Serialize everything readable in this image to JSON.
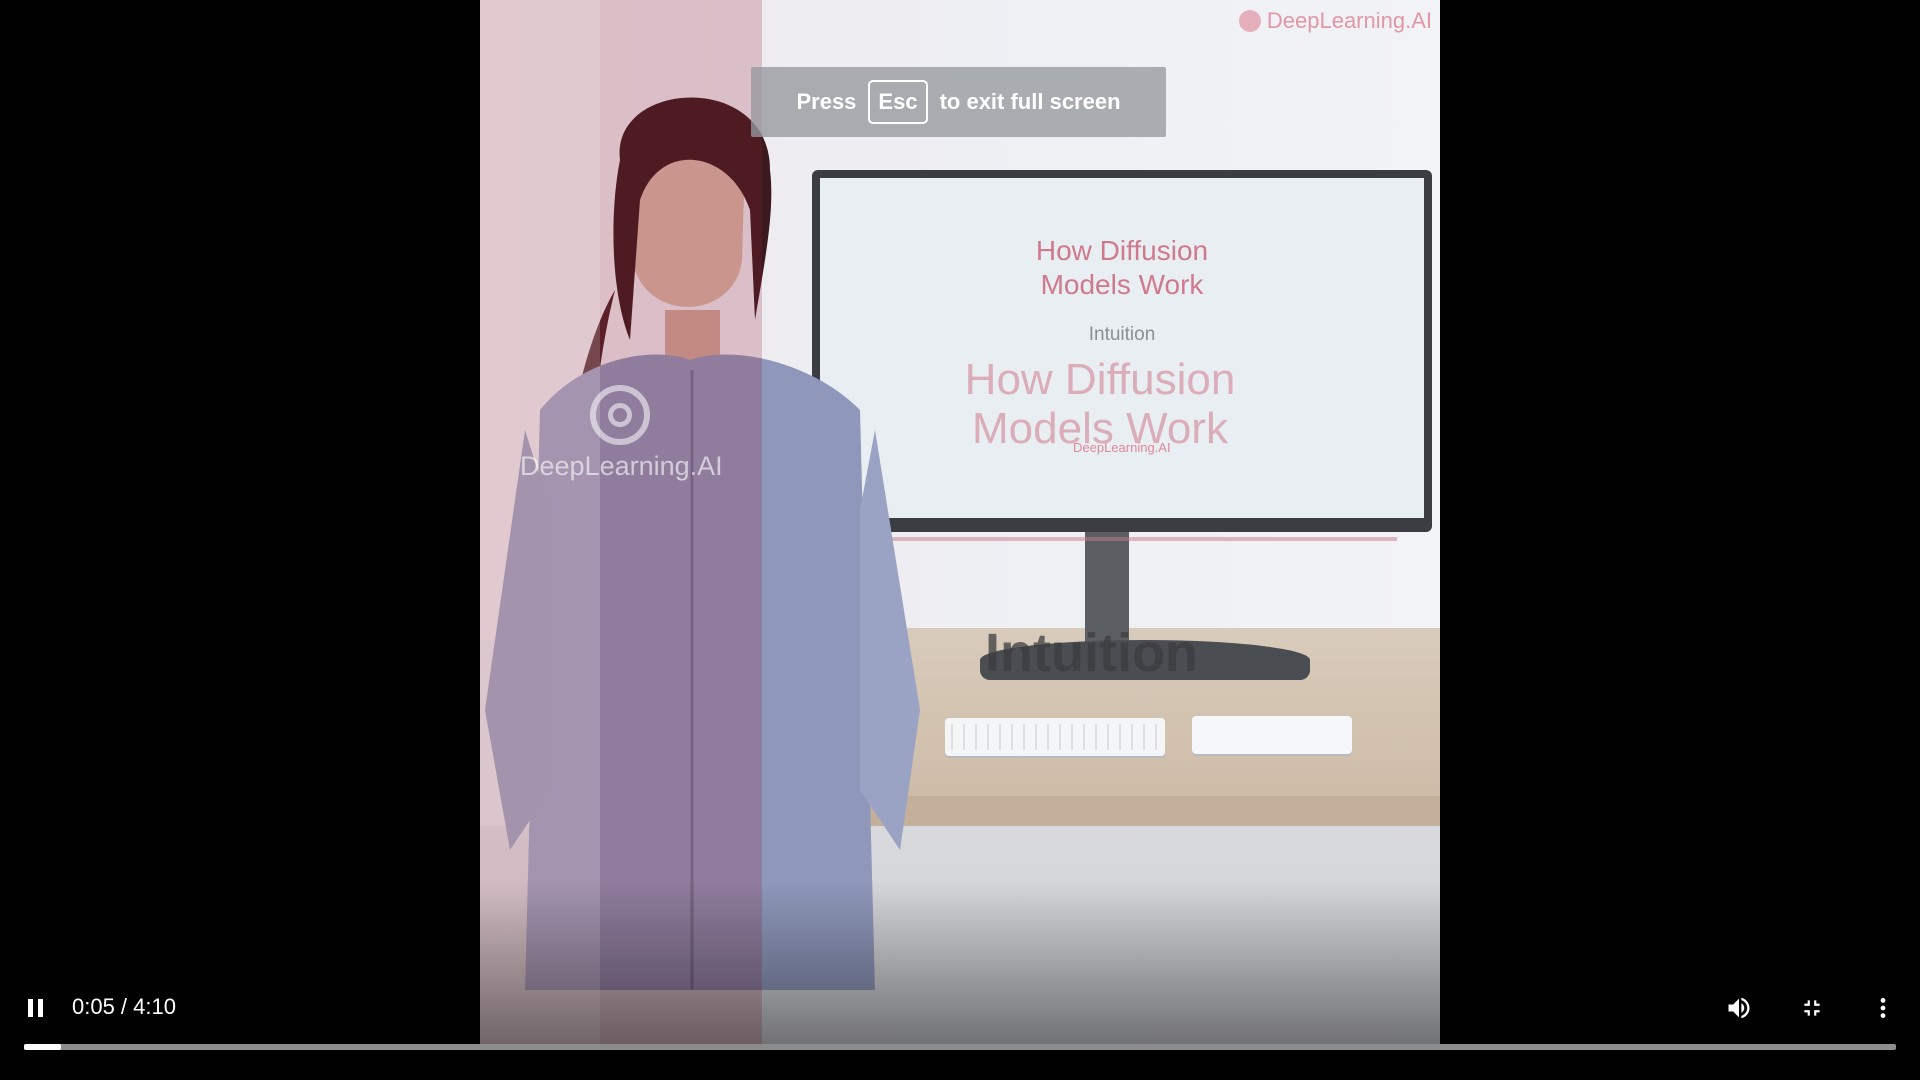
{
  "toast": {
    "press": "Press",
    "key": "Esc",
    "suffix": "to exit full screen"
  },
  "video": {
    "corner_logo": "DeepLearning.AI",
    "side_logo": "DeepLearning.AI",
    "screen_title_line1": "How Diffusion",
    "screen_title_line2": "Models Work",
    "screen_subtitle": "Intuition",
    "ghost_title_line1": "How Diffusion",
    "ghost_title_line2": "Models Work",
    "ghost_logo_text": "DeepLearning.AI",
    "ghost_subtitle": "Intuition"
  },
  "player": {
    "time": "0:05 / 4:10",
    "progress_fraction": 0.02,
    "state": "playing",
    "icons": [
      "pause-icon",
      "volume-icon",
      "exit-fullscreen-icon",
      "more-options-icon"
    ]
  }
}
